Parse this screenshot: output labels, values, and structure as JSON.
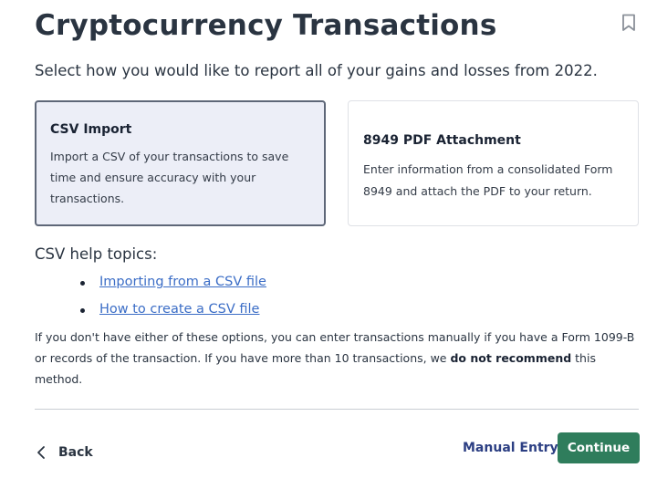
{
  "header": {
    "title": "Cryptocurrency Transactions",
    "subtitle": "Select how you would like to report all of your gains and losses from 2022."
  },
  "options": [
    {
      "title": "CSV Import",
      "description": "Import a CSV of your transactions to save time and ensure accuracy with your transactions.",
      "selected": true
    },
    {
      "title": "8949 PDF Attachment",
      "description": "Enter information from a consolidated Form 8949 and attach the PDF to your return.",
      "selected": false
    }
  ],
  "help": {
    "heading": "CSV help topics:",
    "links": [
      "Importing from a CSV file",
      "How to create a CSV file"
    ]
  },
  "info": {
    "text_before": "If you don't have either of these options, you can enter transactions manually if you have a Form 1099-B or records of the transaction. If you have more than 10 transactions, we ",
    "emphasis": "do not recommend",
    "text_after": " this method."
  },
  "footer": {
    "back_label": "Back",
    "manual_entry_label": "Manual Entry",
    "continue_label": "Continue"
  },
  "colors": {
    "primary_button": "#2f7d5c",
    "link": "#3b6dc6",
    "selected_card_bg": "#eceef7",
    "manual_entry_text": "#2c3f83"
  },
  "icons": {
    "bookmark": "bookmark-icon",
    "back": "chevron-left-icon"
  }
}
